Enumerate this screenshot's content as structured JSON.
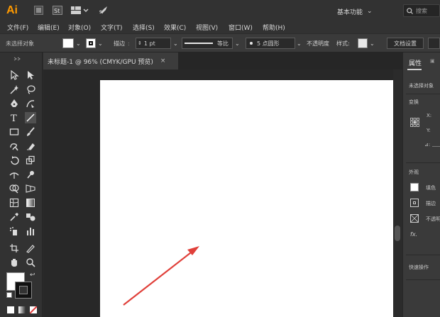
{
  "app": {
    "logo": "Ai",
    "workspace": "基本功能",
    "search_placeholder": "搜索",
    "icons": [
      "bridge-icon",
      "stock-icon",
      "arrange-documents-icon",
      "gpu-rocket-icon"
    ]
  },
  "menu": [
    "文件(F)",
    "编辑(E)",
    "对象(O)",
    "文字(T)",
    "选择(S)",
    "效果(C)",
    "视图(V)",
    "窗口(W)",
    "帮助(H)"
  ],
  "control": {
    "selection_state": "未选择对象",
    "stroke_label": "描边",
    "stroke_value": "1 pt",
    "profile_label": "等比",
    "brush_value": "5 点圆形",
    "opacity_label": "不透明度",
    "style_label": "样式:",
    "doc_setup": "文档设置"
  },
  "document": {
    "tab_title": "未标题-1 @ 96% (CMYK/GPU 预览)",
    "close": "×"
  },
  "panel": {
    "tab": "属性",
    "selection_state": "未选择对象",
    "transform_label": "变换",
    "x_label": "X:",
    "y_label": "Y:",
    "angle_label": "⊿:",
    "appearance_label": "外观",
    "fill_label": "填色",
    "stroke_label": "描边",
    "opacity_label": "不透明",
    "fx_label": "fx.",
    "quick_actions": "快速操作"
  },
  "colors": {
    "annotation_arrow": "#e0403a",
    "app_logo": "#ff9a00"
  }
}
